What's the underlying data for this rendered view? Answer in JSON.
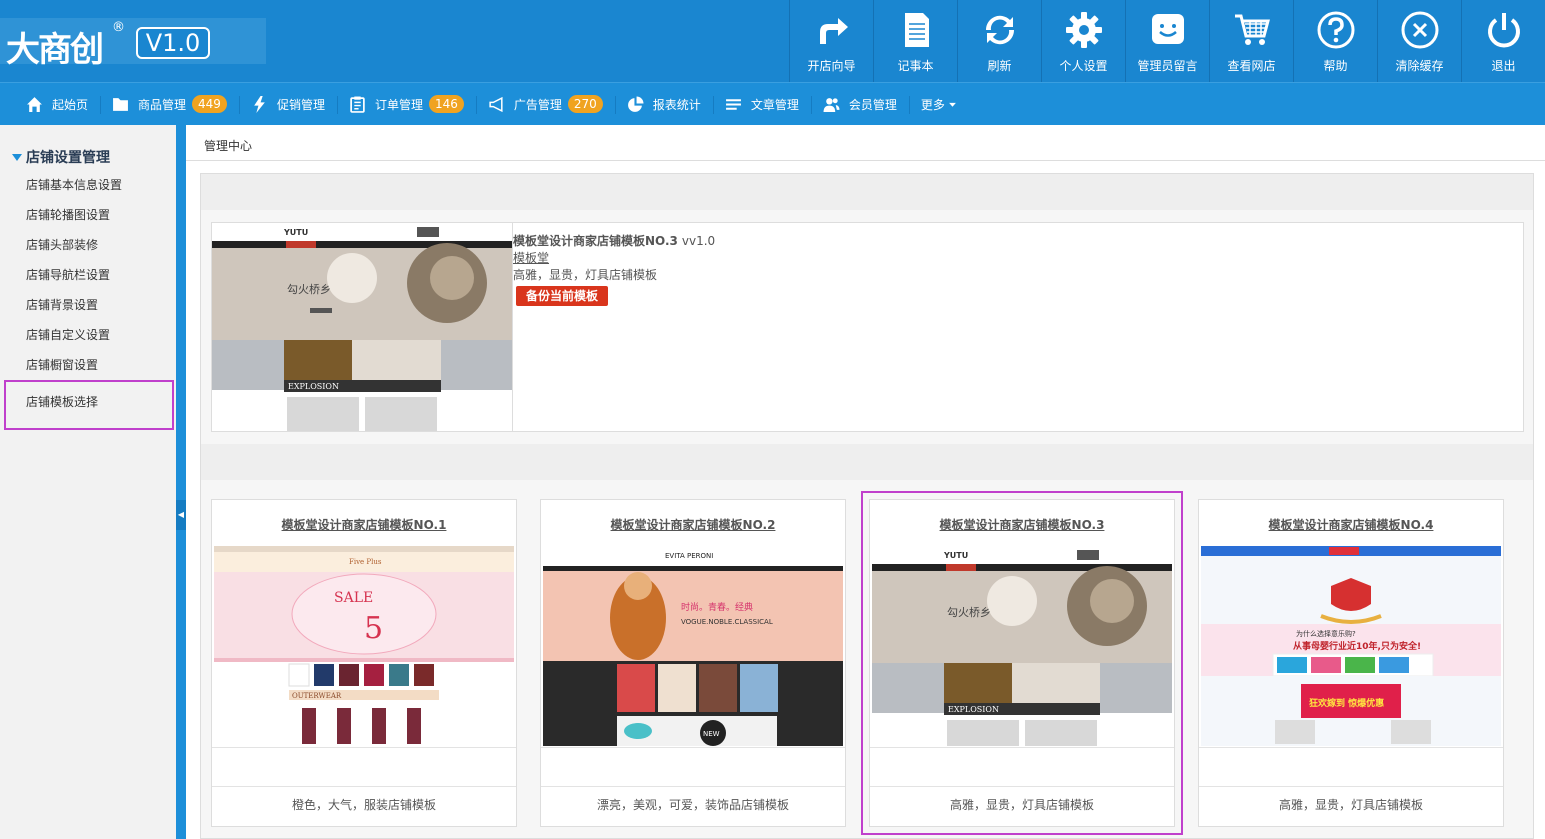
{
  "header": {
    "logo_text": "大商创",
    "logo_mark": "®",
    "version": "V1.0",
    "tools": [
      {
        "label": "开店向导",
        "icon": "share-arrow-icon"
      },
      {
        "label": "记事本",
        "icon": "notepad-icon"
      },
      {
        "label": "刷新",
        "icon": "refresh-icon"
      },
      {
        "label": "个人设置",
        "icon": "gear-icon"
      },
      {
        "label": "管理员留言",
        "icon": "smiley-message-icon"
      },
      {
        "label": "查看网店",
        "icon": "cart-icon"
      },
      {
        "label": "帮助",
        "icon": "help-icon"
      },
      {
        "label": "清除缓存",
        "icon": "clear-cache-icon"
      },
      {
        "label": "退出",
        "icon": "power-icon"
      }
    ]
  },
  "nav": {
    "items": [
      {
        "label": "起始页",
        "icon": "home-icon",
        "badge": ""
      },
      {
        "label": "商品管理",
        "icon": "folder-icon",
        "badge": "449"
      },
      {
        "label": "促销管理",
        "icon": "lightning-icon",
        "badge": ""
      },
      {
        "label": "订单管理",
        "icon": "order-list-icon",
        "badge": "146"
      },
      {
        "label": "广告管理",
        "icon": "megaphone-icon",
        "badge": "270"
      },
      {
        "label": "报表统计",
        "icon": "pie-chart-icon",
        "badge": ""
      },
      {
        "label": "文章管理",
        "icon": "lines-icon",
        "badge": ""
      },
      {
        "label": "会员管理",
        "icon": "users-icon",
        "badge": ""
      },
      {
        "label": "更多",
        "icon": "caret-down-icon",
        "badge": ""
      }
    ]
  },
  "sidebar": {
    "heading": "店铺设置管理",
    "items": [
      {
        "label": "店铺基本信息设置"
      },
      {
        "label": "店铺轮播图设置"
      },
      {
        "label": "店铺头部装修"
      },
      {
        "label": "店铺导航栏设置"
      },
      {
        "label": "店铺背景设置"
      },
      {
        "label": "店铺自定义设置"
      },
      {
        "label": "店铺橱窗设置"
      },
      {
        "label": "店铺模板选择"
      }
    ],
    "active_index": 7
  },
  "breadcrumb": "管理中心",
  "current_template": {
    "title": "模板堂设计商家店铺模板NO.3",
    "version": "vv1.0",
    "author": "模板堂",
    "description": "高雅，显贵，灯具店铺模板",
    "backup_button": "备份当前模板"
  },
  "templates": [
    {
      "name": "模板堂设计商家店铺模板NO.1",
      "description": "橙色，大气，服装店铺模板",
      "selected": false
    },
    {
      "name": "模板堂设计商家店铺模板NO.2",
      "description": "漂亮，美观，可爱，装饰品店铺模板",
      "selected": false
    },
    {
      "name": "模板堂设计商家店铺模板NO.3",
      "description": "高雅，显贵，灯具店铺模板",
      "selected": true
    },
    {
      "name": "模板堂设计商家店铺模板NO.4",
      "description": "高雅，显贵，灯具店铺模板",
      "selected": false
    }
  ],
  "thumb_text": {
    "yutu": "YUTU",
    "explosion": "EXPLOSION",
    "fiveplus": "Five Plus",
    "sale": "SALE",
    "five": "5",
    "outerwear": "OUTERWEAR",
    "evita": "EVITA PERONI",
    "vogue": "VOGUE.NOBLE.CLASSICAL",
    "cn_slogan": "时尚。青春。经典",
    "new": "NEW",
    "mom_title": "从事母婴行业近10年,只为安全!",
    "mom_sub": "为什么选择意乐购?",
    "mom_promo": "狂欢嫁到 惊爆优惠"
  }
}
